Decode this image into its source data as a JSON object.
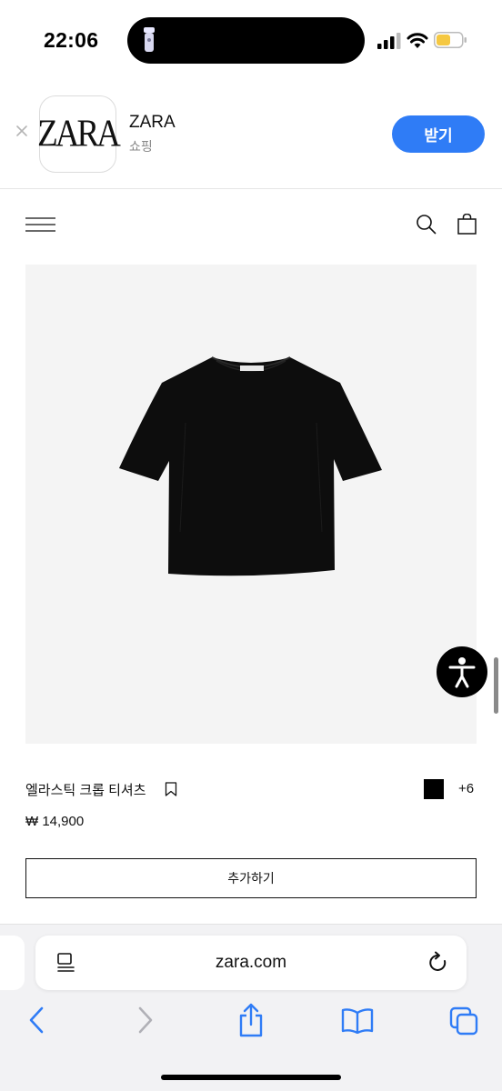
{
  "status_bar": {
    "time": "22:06",
    "icons": [
      "flashlight-icon",
      "cellular-signal-icon",
      "wifi-icon",
      "battery-icon"
    ],
    "battery_color": "#f5c842"
  },
  "app_banner": {
    "app_name": "ZARA",
    "category": "쇼핑",
    "logo_text": "ZARA",
    "get_label": "받기",
    "accent_color": "#2f7cf6"
  },
  "site_header": {
    "icons": [
      "hamburger-menu-icon",
      "search-icon",
      "shopping-bag-icon"
    ]
  },
  "product": {
    "name": "엘라스틱 크롭 티셔츠",
    "price": "₩ 14,900",
    "color_swatch": "#000000",
    "more_colors": "+6",
    "add_label": "추가하기"
  },
  "safari": {
    "url": "zara.com",
    "icons": [
      "reader-icon",
      "reload-icon",
      "back-icon",
      "forward-icon",
      "share-icon",
      "bookmarks-icon",
      "tabs-icon"
    ]
  }
}
